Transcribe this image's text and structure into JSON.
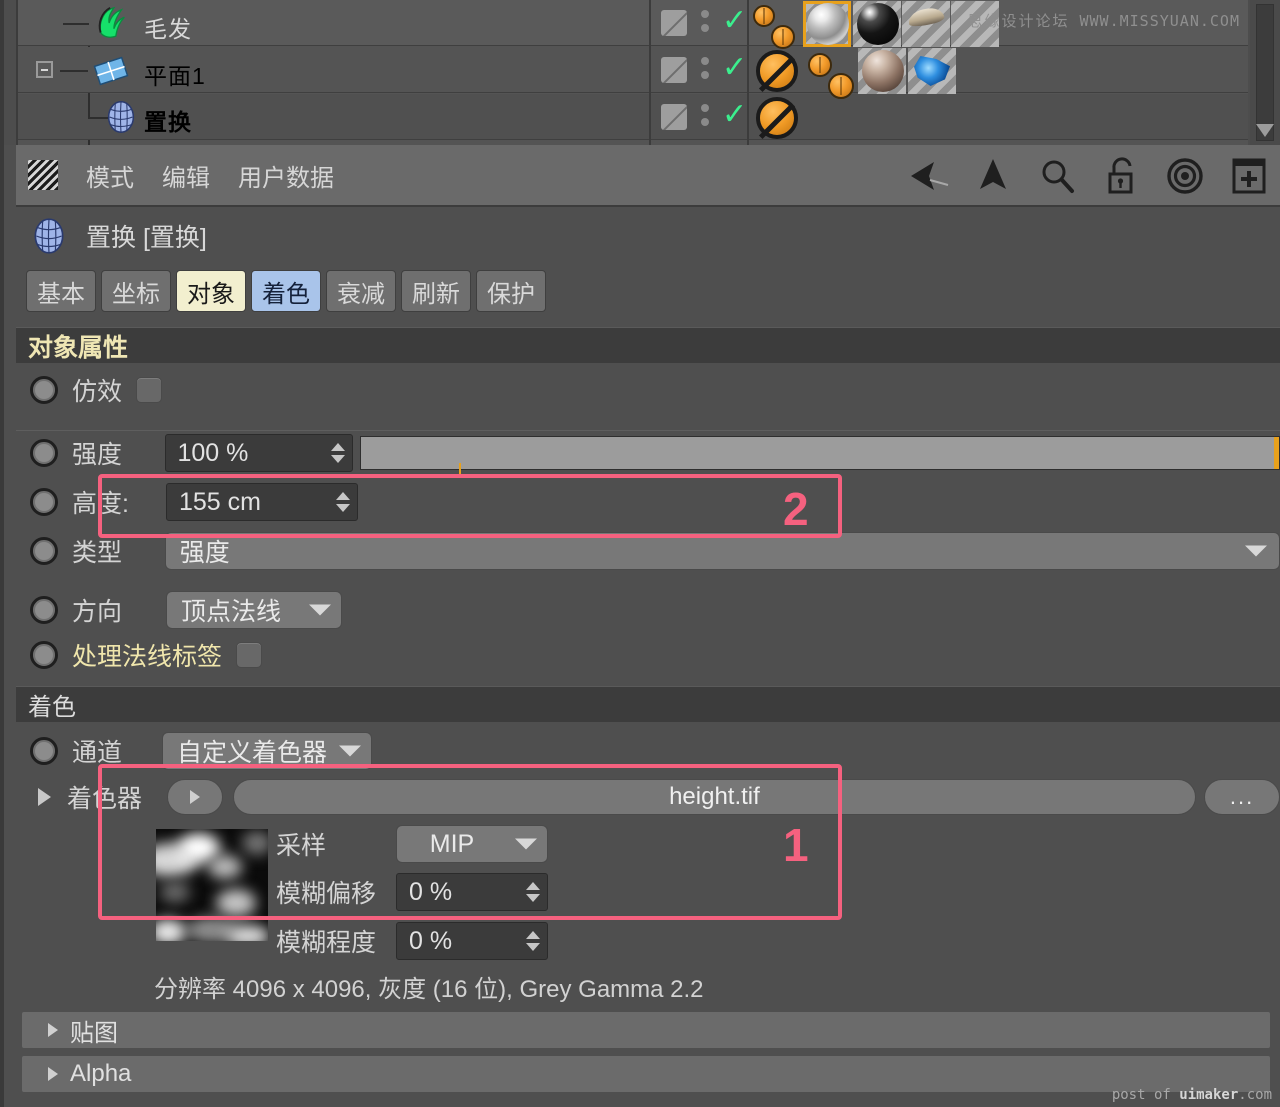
{
  "object_manager": {
    "rows": [
      {
        "label": "毛发",
        "icon": "hair-icon",
        "label_color": "#d8d8d8",
        "indent": 1
      },
      {
        "label": "平面1",
        "icon": "plane-icon",
        "label_color": "#e8a11c",
        "indent": 1
      },
      {
        "label": "置换",
        "icon": "displacer-icon",
        "label_color": "#e8c021",
        "indent": 2
      }
    ],
    "watermark": {
      "cn": "思缘设计论坛",
      "url": "WWW.MISSYUAN.COM"
    }
  },
  "menubar": {
    "items": [
      {
        "label": "模式"
      },
      {
        "label": "编辑"
      },
      {
        "label": "用户数据"
      }
    ],
    "tools": [
      "back-arrow-icon",
      "forward-arrow-icon",
      "search-icon",
      "unlock-icon",
      "target-icon",
      "add-panel-icon"
    ]
  },
  "object_header": {
    "title": "置换 [置换]"
  },
  "tabs": [
    {
      "label": "基本",
      "state": "normal"
    },
    {
      "label": "坐标",
      "state": "normal"
    },
    {
      "label": "对象",
      "state": "active"
    },
    {
      "label": "着色",
      "state": "highlight"
    },
    {
      "label": "衰减",
      "state": "normal"
    },
    {
      "label": "刷新",
      "state": "normal"
    },
    {
      "label": "保护",
      "state": "normal"
    }
  ],
  "object_properties": {
    "section_title": "对象属性",
    "emulate": {
      "label": "仿效",
      "checked": false
    },
    "strength": {
      "label": "强度",
      "value": "100 %",
      "slider_percent": 100
    },
    "height": {
      "label": "高度:",
      "value": "155 cm"
    },
    "type": {
      "label": "类型",
      "value": "强度"
    },
    "direction": {
      "label": "方向",
      "value": "顶点法线"
    },
    "process_normal_tag": {
      "label": "处理法线标签",
      "checked": false
    }
  },
  "shading": {
    "section_title": "着色",
    "channel": {
      "label": "通道",
      "value": "自定义着色器"
    },
    "shader": {
      "label": "着色器",
      "texture_name": "height.tif",
      "browse_label": "...",
      "sampling": {
        "label": "采样",
        "value": "MIP"
      },
      "blur_offset": {
        "label": "模糊偏移",
        "value": "0 %"
      },
      "blur_scale": {
        "label": "模糊程度",
        "value": "0 %"
      },
      "resolution_info": "分辨率 4096 x 4096, 灰度 (16 位), Grey Gamma 2.2"
    },
    "collapsed": [
      {
        "label": "贴图"
      },
      {
        "label": "Alpha"
      }
    ]
  },
  "annotations": [
    {
      "id": "1",
      "number": "1"
    },
    {
      "id": "2",
      "number": "2"
    }
  ],
  "colors": {
    "accent_orange": "#e8a11c",
    "annotation_pink": "#f5617f",
    "tab_active": "#f2efcf",
    "tab_highlight": "#a9c4ea",
    "section_title": "#efe6b4"
  },
  "watermark_bottom": {
    "pre": "post of ",
    "brand": "uimaker",
    "post": ".com"
  }
}
